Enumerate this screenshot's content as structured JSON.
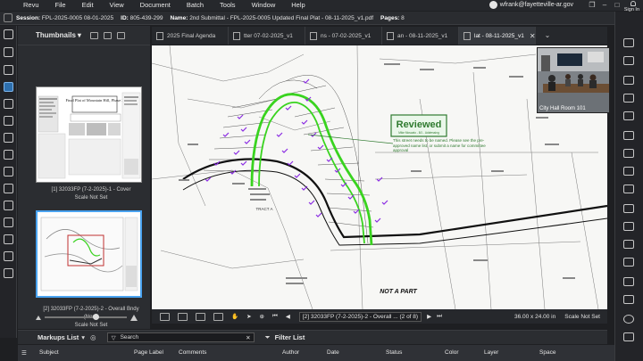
{
  "menubar": {
    "items": [
      "Revu",
      "File",
      "Edit",
      "View",
      "Document",
      "Batch",
      "Tools",
      "Window",
      "Help"
    ],
    "user_email": "wfrank@fayetteville-ar.gov",
    "sign_in": "Sign In"
  },
  "session": {
    "label": "Session:",
    "session_name": "FPL-2025-0005 08-01-2025",
    "id_label": "ID:",
    "id_value": "805-439-299",
    "name_label": "Name:",
    "name_value": "2nd Submittal - FPL-2025-0005 Updated Final Plat - 08-11-2025_v1.pdf",
    "pages_label": "Pages:",
    "pages_value": "8"
  },
  "thumbnails": {
    "title": "Thumbnails",
    "items": [
      {
        "caption": "[1] 32033FP (7-2-2025)-1 - Cover",
        "scale": "Scale Not Set",
        "page_title": "Final Plat of Mountain Hill, Phase 2"
      },
      {
        "caption": "[2] 32033FP (7-2-2025)-2 - Overall Bndy (Nor...",
        "scale": "Scale Not Set"
      }
    ]
  },
  "tabs": [
    {
      "label": "2025 Final Agenda",
      "active": false
    },
    {
      "label": "tter 07-02-2025_v1",
      "active": false
    },
    {
      "label": "ns - 07-02-2025_v1",
      "active": false
    },
    {
      "label": "an - 08-11-2025_v1",
      "active": false
    },
    {
      "label": "lat - 08-11-2025_v1",
      "active": true
    }
  ],
  "document": {
    "stamp_title": "Reviewed",
    "stamp_line": "Mike Moscato - 8/1 - Addressing",
    "note": "This street needs to be named. Please see the pre-approved name list, or submit a name for committee approval",
    "tract_label": "TRACT A",
    "not_a_part": "NOT A PART"
  },
  "navbar": {
    "page_indicator": "[2] 32033FP (7-2-2025)-2 - Overall ... (2 of 8)",
    "paper_size": "36.00 x 24.00 in",
    "scale": "Scale Not Set"
  },
  "markups": {
    "title": "Markups List",
    "search_placeholder": "Search",
    "filter_title": "Filter List",
    "columns": [
      "Subject",
      "Page Label",
      "Comments",
      "Author",
      "Date",
      "Status",
      "Color",
      "Layer",
      "Space"
    ]
  },
  "webcam": {
    "label": "City Hall Room 101"
  },
  "colors": {
    "accent": "#2d6fae",
    "highlight_green": "#39d31f",
    "markup_purple": "#8a2be2",
    "stamp_green": "#2f7a2f"
  }
}
